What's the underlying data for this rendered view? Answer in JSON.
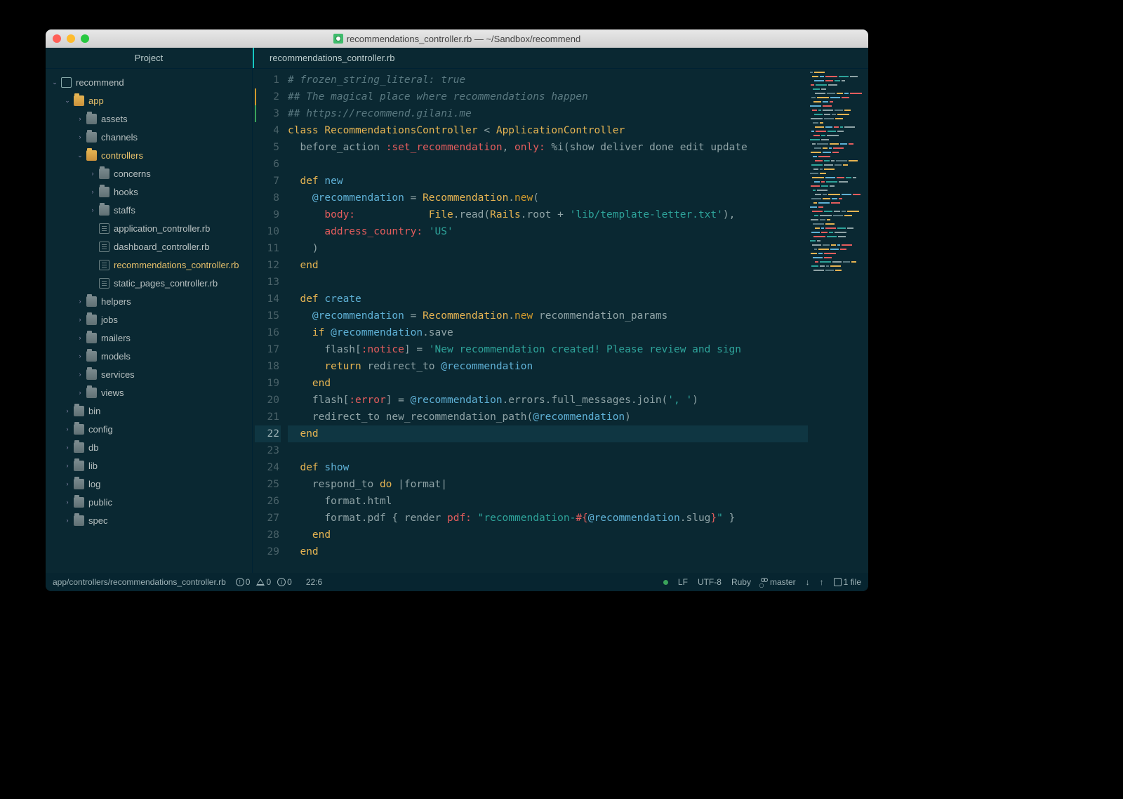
{
  "window": {
    "title": "recommendations_controller.rb — ~/Sandbox/recommend"
  },
  "project_header": "Project",
  "tab": {
    "label": "recommendations_controller.rb"
  },
  "tree": [
    {
      "depth": 0,
      "chev": "down",
      "icon": "repo",
      "label": "recommend",
      "active": false
    },
    {
      "depth": 1,
      "chev": "down",
      "icon": "folder-open",
      "label": "app",
      "active": true
    },
    {
      "depth": 2,
      "chev": "right",
      "icon": "folder",
      "label": "assets",
      "active": false
    },
    {
      "depth": 2,
      "chev": "right",
      "icon": "folder",
      "label": "channels",
      "active": false
    },
    {
      "depth": 2,
      "chev": "down",
      "icon": "folder-open",
      "label": "controllers",
      "active": true
    },
    {
      "depth": 3,
      "chev": "right",
      "icon": "folder",
      "label": "concerns",
      "active": false
    },
    {
      "depth": 3,
      "chev": "right",
      "icon": "folder",
      "label": "hooks",
      "active": false
    },
    {
      "depth": 3,
      "chev": "right",
      "icon": "folder",
      "label": "staffs",
      "active": false
    },
    {
      "depth": 3,
      "chev": "",
      "icon": "file",
      "label": "application_controller.rb",
      "active": false
    },
    {
      "depth": 3,
      "chev": "",
      "icon": "file",
      "label": "dashboard_controller.rb",
      "active": false
    },
    {
      "depth": 3,
      "chev": "",
      "icon": "file",
      "label": "recommendations_controller.rb",
      "active": true
    },
    {
      "depth": 3,
      "chev": "",
      "icon": "file",
      "label": "static_pages_controller.rb",
      "active": false
    },
    {
      "depth": 2,
      "chev": "right",
      "icon": "folder",
      "label": "helpers",
      "active": false
    },
    {
      "depth": 2,
      "chev": "right",
      "icon": "folder",
      "label": "jobs",
      "active": false
    },
    {
      "depth": 2,
      "chev": "right",
      "icon": "folder",
      "label": "mailers",
      "active": false
    },
    {
      "depth": 2,
      "chev": "right",
      "icon": "folder",
      "label": "models",
      "active": false
    },
    {
      "depth": 2,
      "chev": "right",
      "icon": "folder",
      "label": "services",
      "active": false
    },
    {
      "depth": 2,
      "chev": "right",
      "icon": "folder",
      "label": "views",
      "active": false
    },
    {
      "depth": 1,
      "chev": "right",
      "icon": "folder",
      "label": "bin",
      "active": false
    },
    {
      "depth": 1,
      "chev": "right",
      "icon": "folder",
      "label": "config",
      "active": false
    },
    {
      "depth": 1,
      "chev": "right",
      "icon": "folder",
      "label": "db",
      "active": false
    },
    {
      "depth": 1,
      "chev": "right",
      "icon": "folder",
      "label": "lib",
      "active": false
    },
    {
      "depth": 1,
      "chev": "right",
      "icon": "folder",
      "label": "log",
      "active": false
    },
    {
      "depth": 1,
      "chev": "right",
      "icon": "folder",
      "label": "public",
      "active": false
    },
    {
      "depth": 1,
      "chev": "right",
      "icon": "folder",
      "label": "spec",
      "active": false
    }
  ],
  "editor": {
    "current_line": 22,
    "lines": [
      {
        "n": 1,
        "git": "",
        "tokens": [
          [
            "c-comment",
            "# frozen_string_literal: true"
          ]
        ]
      },
      {
        "n": 2,
        "git": "mod",
        "tokens": [
          [
            "c-comment",
            "## The magical place where recommendations happen"
          ]
        ]
      },
      {
        "n": 3,
        "git": "add",
        "tokens": [
          [
            "c-comment",
            "## https://recommend.gilani.me"
          ]
        ]
      },
      {
        "n": 4,
        "git": "",
        "tokens": [
          [
            "c-kw",
            "class "
          ],
          [
            "c-class",
            "RecommendationsController"
          ],
          [
            "c-punc",
            " < "
          ],
          [
            "c-class",
            "ApplicationController"
          ]
        ]
      },
      {
        "n": 5,
        "git": "",
        "tokens": [
          [
            "",
            "  before_action "
          ],
          [
            "c-sym",
            ":set_recommendation"
          ],
          [
            "c-punc",
            ", "
          ],
          [
            "c-sym",
            "only:"
          ],
          [
            "c-punc",
            " %i("
          ],
          [
            "",
            "show deliver done edit update"
          ]
        ]
      },
      {
        "n": 6,
        "git": "",
        "tokens": [
          [
            "",
            ""
          ]
        ]
      },
      {
        "n": 7,
        "git": "",
        "tokens": [
          [
            "",
            "  "
          ],
          [
            "c-kw",
            "def "
          ],
          [
            "c-def",
            "new"
          ]
        ]
      },
      {
        "n": 8,
        "git": "",
        "tokens": [
          [
            "",
            "    "
          ],
          [
            "c-ivar",
            "@recommendation"
          ],
          [
            "c-punc",
            " = "
          ],
          [
            "c-class",
            "Recommendation"
          ],
          [
            "c-punc",
            "."
          ],
          [
            "c-kw2",
            "new"
          ],
          [
            "c-punc",
            "("
          ]
        ]
      },
      {
        "n": 9,
        "git": "",
        "tokens": [
          [
            "",
            "      "
          ],
          [
            "c-sym",
            "body:"
          ],
          [
            "",
            "            "
          ],
          [
            "c-class",
            "File"
          ],
          [
            "c-punc",
            ".read("
          ],
          [
            "c-class",
            "Rails"
          ],
          [
            "c-punc",
            ".root + "
          ],
          [
            "c-str",
            "'lib/template-letter.txt'"
          ],
          [
            "c-punc",
            "),"
          ]
        ]
      },
      {
        "n": 10,
        "git": "",
        "tokens": [
          [
            "",
            "      "
          ],
          [
            "c-sym",
            "address_country:"
          ],
          [
            "c-punc",
            " "
          ],
          [
            "c-str",
            "'US'"
          ]
        ]
      },
      {
        "n": 11,
        "git": "",
        "tokens": [
          [
            "",
            "    "
          ],
          [
            "c-punc",
            ")"
          ]
        ]
      },
      {
        "n": 12,
        "git": "",
        "tokens": [
          [
            "",
            "  "
          ],
          [
            "c-kw",
            "end"
          ]
        ]
      },
      {
        "n": 13,
        "git": "",
        "tokens": [
          [
            "",
            ""
          ]
        ]
      },
      {
        "n": 14,
        "git": "",
        "tokens": [
          [
            "",
            "  "
          ],
          [
            "c-kw",
            "def "
          ],
          [
            "c-def",
            "create"
          ]
        ]
      },
      {
        "n": 15,
        "git": "",
        "tokens": [
          [
            "",
            "    "
          ],
          [
            "c-ivar",
            "@recommendation"
          ],
          [
            "c-punc",
            " = "
          ],
          [
            "c-class",
            "Recommendation"
          ],
          [
            "c-punc",
            "."
          ],
          [
            "c-kw2",
            "new"
          ],
          [
            "c-punc",
            " recommendation_params"
          ]
        ]
      },
      {
        "n": 16,
        "git": "",
        "tokens": [
          [
            "",
            "    "
          ],
          [
            "c-kw",
            "if "
          ],
          [
            "c-ivar",
            "@recommendation"
          ],
          [
            "c-punc",
            ".save"
          ]
        ]
      },
      {
        "n": 17,
        "git": "",
        "tokens": [
          [
            "",
            "      flash["
          ],
          [
            "c-sym",
            ":notice"
          ],
          [
            "c-punc",
            "] = "
          ],
          [
            "c-str",
            "'New recommendation created! Please review and sign"
          ]
        ]
      },
      {
        "n": 18,
        "git": "",
        "tokens": [
          [
            "",
            "      "
          ],
          [
            "c-kw",
            "return"
          ],
          [
            "c-punc",
            " redirect_to "
          ],
          [
            "c-ivar",
            "@recommendation"
          ]
        ]
      },
      {
        "n": 19,
        "git": "",
        "tokens": [
          [
            "",
            "    "
          ],
          [
            "c-kw",
            "end"
          ]
        ]
      },
      {
        "n": 20,
        "git": "",
        "tokens": [
          [
            "",
            "    flash["
          ],
          [
            "c-sym",
            ":error"
          ],
          [
            "c-punc",
            "] = "
          ],
          [
            "c-ivar",
            "@recommendation"
          ],
          [
            "c-punc",
            ".errors.full_messages.join("
          ],
          [
            "c-str",
            "', '"
          ],
          [
            "c-punc",
            ")"
          ]
        ]
      },
      {
        "n": 21,
        "git": "",
        "tokens": [
          [
            "",
            "    redirect_to new_recommendation_path("
          ],
          [
            "c-ivar",
            "@recommendation"
          ],
          [
            "c-punc",
            ")"
          ]
        ]
      },
      {
        "n": 22,
        "git": "",
        "tokens": [
          [
            "",
            "  "
          ],
          [
            "c-kw",
            "end"
          ]
        ]
      },
      {
        "n": 23,
        "git": "",
        "tokens": [
          [
            "",
            ""
          ]
        ]
      },
      {
        "n": 24,
        "git": "",
        "tokens": [
          [
            "",
            "  "
          ],
          [
            "c-kw",
            "def "
          ],
          [
            "c-def",
            "show"
          ]
        ]
      },
      {
        "n": 25,
        "git": "",
        "tokens": [
          [
            "",
            "    respond_to "
          ],
          [
            "c-kw",
            "do"
          ],
          [
            "c-punc",
            " |"
          ],
          [
            "",
            "format"
          ],
          [
            "c-punc",
            "|"
          ]
        ]
      },
      {
        "n": 26,
        "git": "",
        "tokens": [
          [
            "",
            "      format.html"
          ]
        ]
      },
      {
        "n": 27,
        "git": "",
        "tokens": [
          [
            "",
            "      format.pdf { render "
          ],
          [
            "c-sym",
            "pdf:"
          ],
          [
            "c-punc",
            " "
          ],
          [
            "c-str",
            "\"recommendation-"
          ],
          [
            "c-interp-d",
            "#{"
          ],
          [
            "c-interp-in",
            "@recommendation"
          ],
          [
            "c-punc",
            ".slug"
          ],
          [
            "c-interp-d",
            "}"
          ],
          [
            "c-str",
            "\""
          ],
          [
            "c-punc",
            " }"
          ]
        ]
      },
      {
        "n": 28,
        "git": "",
        "tokens": [
          [
            "",
            "    "
          ],
          [
            "c-kw",
            "end"
          ]
        ]
      },
      {
        "n": 29,
        "git": "",
        "tokens": [
          [
            "",
            "  "
          ],
          [
            "c-kw",
            "end"
          ]
        ]
      }
    ]
  },
  "status": {
    "path": "app/controllers/recommendations_controller.rb",
    "errors": "0",
    "warnings": "0",
    "info": "0",
    "cursor": "22:6",
    "line_ending": "LF",
    "encoding": "UTF-8",
    "language": "Ruby",
    "branch": "master",
    "files": "1 file"
  },
  "minimap_colors": [
    "#5a7981",
    "#e6b452",
    "#5fb1d6",
    "#e55d5d",
    "#2ea39a",
    "#8fa3a6"
  ]
}
